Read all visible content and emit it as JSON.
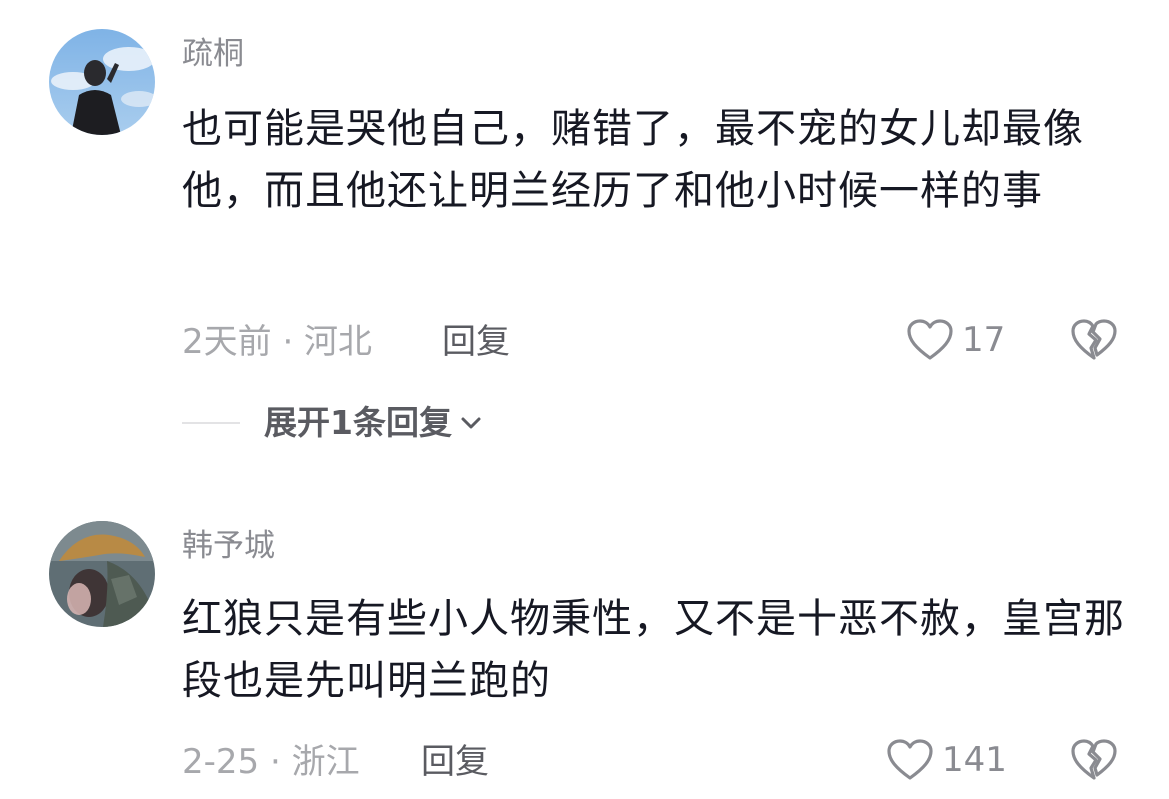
{
  "comments": [
    {
      "username": "疏桐",
      "text": "也可能是哭他自己，赌错了，最不宠的女儿却最像他，而且他还让明兰经历了和他小时候一样的事",
      "time_location": "2天前 · 河北",
      "reply_label": "回复",
      "likes": "17",
      "expand_label": "展开1条回复",
      "avatar_icon": "avatar-photo-icon"
    },
    {
      "username": "韩予城",
      "text": "红狼只是有些小人物秉性，又不是十恶不赦，皇宫那段也是先叫明兰跑的",
      "time_location": "2-25 · 浙江",
      "reply_label": "回复",
      "likes": "141",
      "avatar_icon": "avatar-photo-icon"
    }
  ],
  "icons": {
    "like": "heart-outline-icon",
    "dislike": "broken-heart-icon",
    "expand": "chevron-down-icon"
  },
  "colors": {
    "username": "#8a8b91",
    "body": "#161823",
    "meta": "#a7a8ac",
    "action": "#5a5b61"
  }
}
